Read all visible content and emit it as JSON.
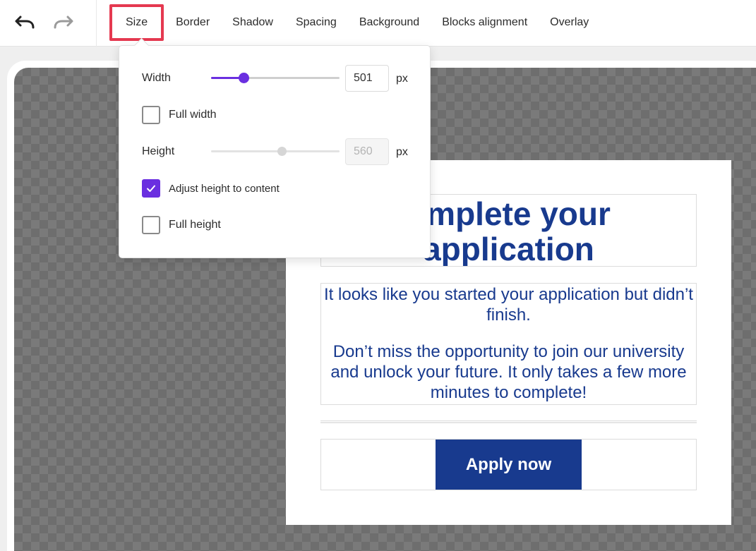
{
  "toolbar": {
    "tabs": [
      {
        "label": "Size",
        "active": true
      },
      {
        "label": "Border"
      },
      {
        "label": "Shadow"
      },
      {
        "label": "Spacing"
      },
      {
        "label": "Background"
      },
      {
        "label": "Blocks alignment"
      },
      {
        "label": "Overlay"
      }
    ],
    "icons": {
      "undo": "undo-icon",
      "redo": "redo-icon"
    }
  },
  "size_panel": {
    "width_label": "Width",
    "width_value": "501",
    "width_slider_level": 0.25,
    "unit": "px",
    "full_width_label": "Full width",
    "full_width_checked": false,
    "height_label": "Height",
    "height_value": "560",
    "height_slider_level": 0.55,
    "adjust_height_label": "Adjust height to content",
    "adjust_height_checked": true,
    "full_height_label": "Full height",
    "full_height_checked": false
  },
  "email": {
    "headline_line1": "omplete your",
    "headline_line2": "application",
    "body_p1": "It looks like you started your application but didn’t finish.",
    "body_p2": "Don’t miss the opportunity to join our university and unlock your future. It only takes a few more minutes to complete!",
    "cta_label": "Apply now"
  },
  "colors": {
    "accent": "#6a2fe0",
    "active_tab_outline": "#e53950",
    "brand_blue": "#183a8e"
  }
}
